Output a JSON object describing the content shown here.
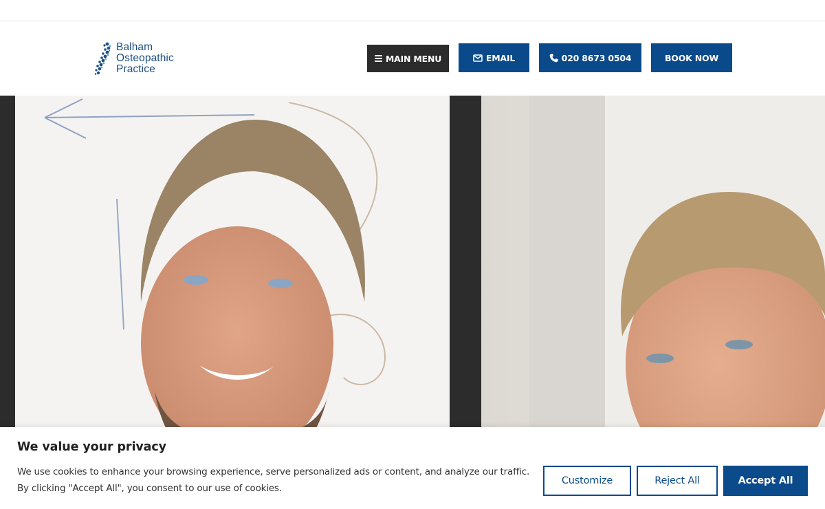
{
  "brand": {
    "logo_lines": [
      "Balham",
      "Osteopathic",
      "Practice"
    ],
    "logo_color": "#1c4f86"
  },
  "nav": {
    "menu_label": "MAIN MENU",
    "menu_icon": "hamburger-icon",
    "email_label": "EMAIL",
    "email_icon": "envelope-icon",
    "phone_label": "020 8673 0504",
    "phone_icon": "phone-icon",
    "book_label": "BOOK NOW",
    "primary_color": "#0a4a8a",
    "menu_color": "#2b2b2b"
  },
  "hero": {
    "image": "photo-of-two-smiling-osteopaths"
  },
  "cookie_banner": {
    "title": "We value your privacy",
    "text_line1": "We use cookies to enhance your browsing experience, serve personalized ads or content, and analyze our traffic.",
    "text_line2": "By clicking \"Accept All\", you consent to our use of cookies.",
    "customize_label": "Customize",
    "reject_label": "Reject All",
    "accept_label": "Accept All",
    "accent_color": "#0b4a8b"
  }
}
